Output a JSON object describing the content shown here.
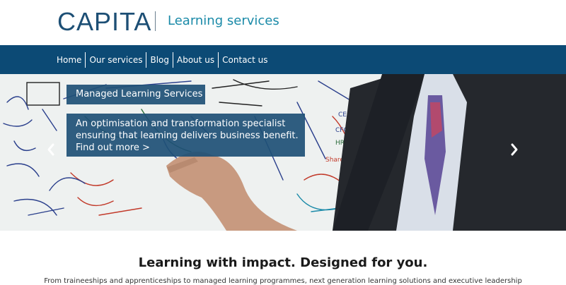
{
  "brand": {
    "logo": "CAPITA",
    "subtitle": "Learning services"
  },
  "nav": {
    "items": [
      "Home",
      "Our services",
      "Blog",
      "About us",
      "Contact us"
    ]
  },
  "hero": {
    "caption_title": "Managed Learning Services",
    "caption_lines": [
      "An optimisation and transformation specialist",
      "ensuring that learning delivers business benefit.",
      "Find out more >"
    ],
    "prev_icon": "chevron-left-icon",
    "next_icon": "chevron-right-icon"
  },
  "main": {
    "tagline": "Learning with impact. Designed for you.",
    "intro": "From traineeships and apprenticeships to managed learning programmes, next generation learning solutions and executive leadership"
  },
  "colors": {
    "brand_blue": "#1d4f75",
    "nav_bg": "#0c4a75",
    "subtitle_teal": "#1a8aa8"
  }
}
